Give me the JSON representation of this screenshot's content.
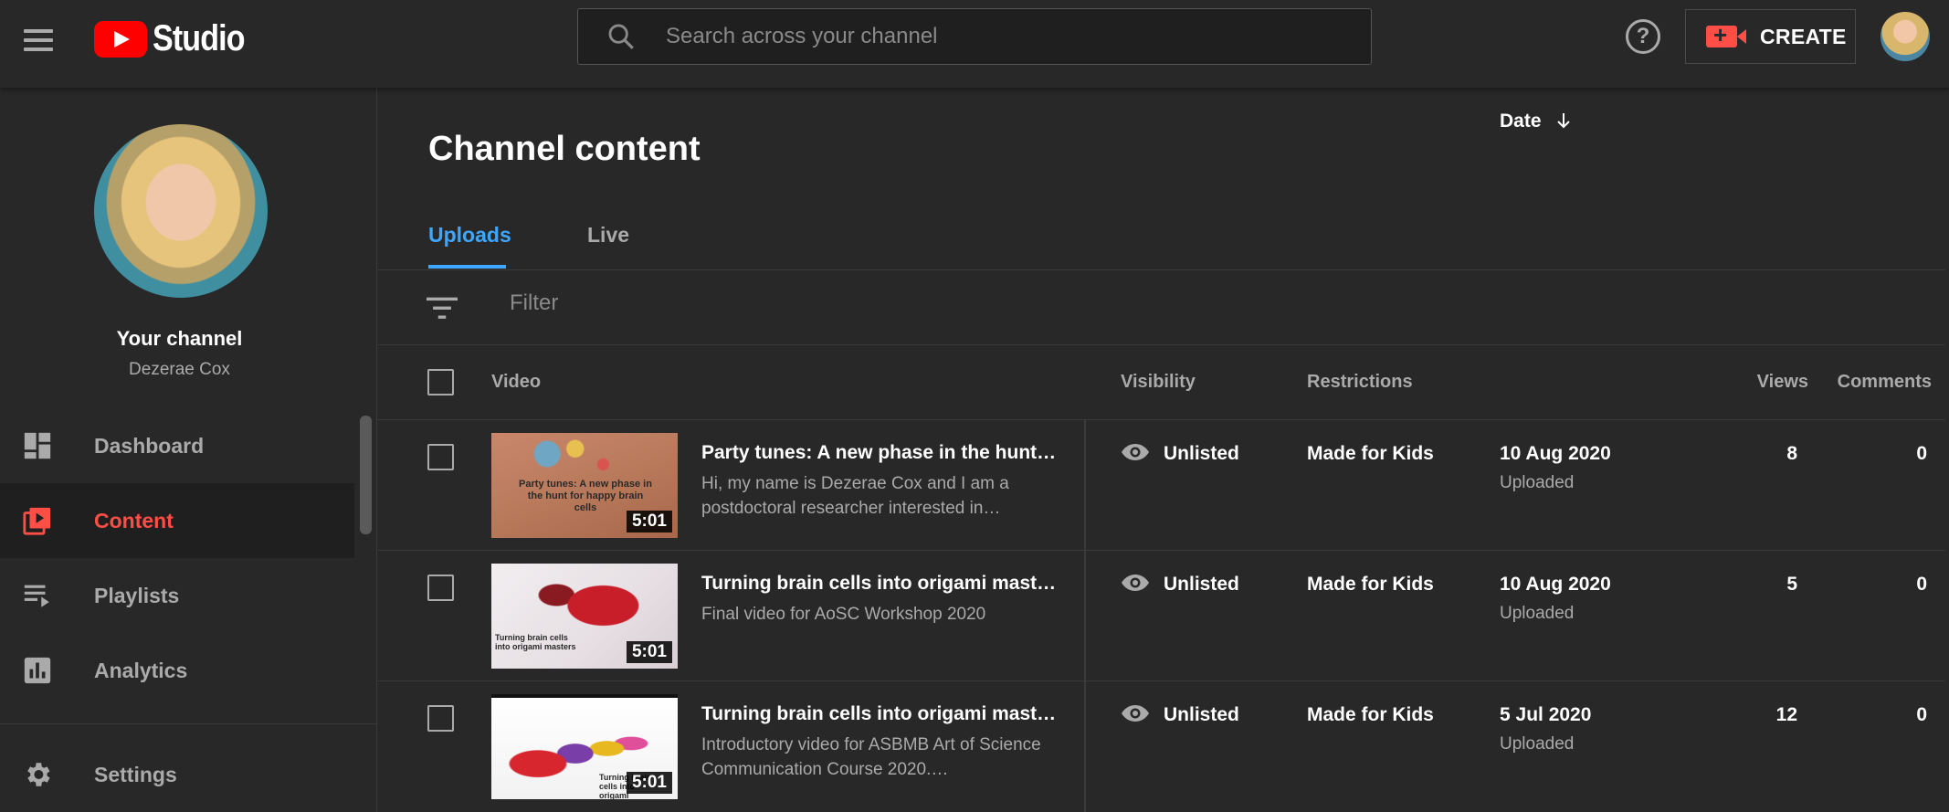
{
  "header": {
    "logo_text": "Studio",
    "search_placeholder": "Search across your channel",
    "help_label": "?",
    "create_label": "CREATE"
  },
  "sidebar": {
    "channel_title": "Your channel",
    "channel_name": "Dezerae Cox",
    "items": [
      {
        "label": "Dashboard",
        "icon": "dashboard-icon",
        "active": false
      },
      {
        "label": "Content",
        "icon": "content-icon",
        "active": true
      },
      {
        "label": "Playlists",
        "icon": "playlists-icon",
        "active": false
      },
      {
        "label": "Analytics",
        "icon": "analytics-icon",
        "active": false
      },
      {
        "label": "Settings",
        "icon": "gear-icon",
        "active": false
      }
    ]
  },
  "main": {
    "title": "Channel content",
    "tabs": [
      {
        "label": "Uploads",
        "active": true
      },
      {
        "label": "Live",
        "active": false
      }
    ],
    "filter_placeholder": "Filter",
    "columns": {
      "video": "Video",
      "visibility": "Visibility",
      "restrictions": "Restrictions",
      "date": "Date",
      "views": "Views",
      "comments": "Comments"
    },
    "rows": [
      {
        "title": "Party tunes: A new phase in the hunt f...",
        "description": "Hi, my name is Dezerae Cox and I am a postdoctoral researcher interested in…",
        "thumb_caption": "Party tunes: A new phase in the hunt for happy brain cells",
        "duration": "5:01",
        "visibility": "Unlisted",
        "restrictions": "Made for Kids",
        "date": "10 Aug 2020",
        "date_status": "Uploaded",
        "views": "8",
        "comments": "0"
      },
      {
        "title": "Turning brain cells into origami masters",
        "description": "Final video for AoSC Workshop 2020",
        "thumb_caption": "Turning brain cells into origami masters",
        "duration": "5:01",
        "visibility": "Unlisted",
        "restrictions": "Made for Kids",
        "date": "10 Aug 2020",
        "date_status": "Uploaded",
        "views": "5",
        "comments": "0"
      },
      {
        "title": "Turning brain cells into origami masters",
        "description": "Introductory video for ASBMB Art of Science Communication Course 2020.…",
        "thumb_caption": "Turning brain cells into origami masters",
        "duration": "5:01",
        "visibility": "Unlisted",
        "restrictions": "Made for Kids",
        "date": "5 Jul 2020",
        "date_status": "Uploaded",
        "views": "12",
        "comments": "0"
      }
    ]
  },
  "colors": {
    "background": "#282828",
    "accent_red": "#ff4e45",
    "accent_blue": "#3ea6ff",
    "youtube_red": "#ff0000"
  }
}
